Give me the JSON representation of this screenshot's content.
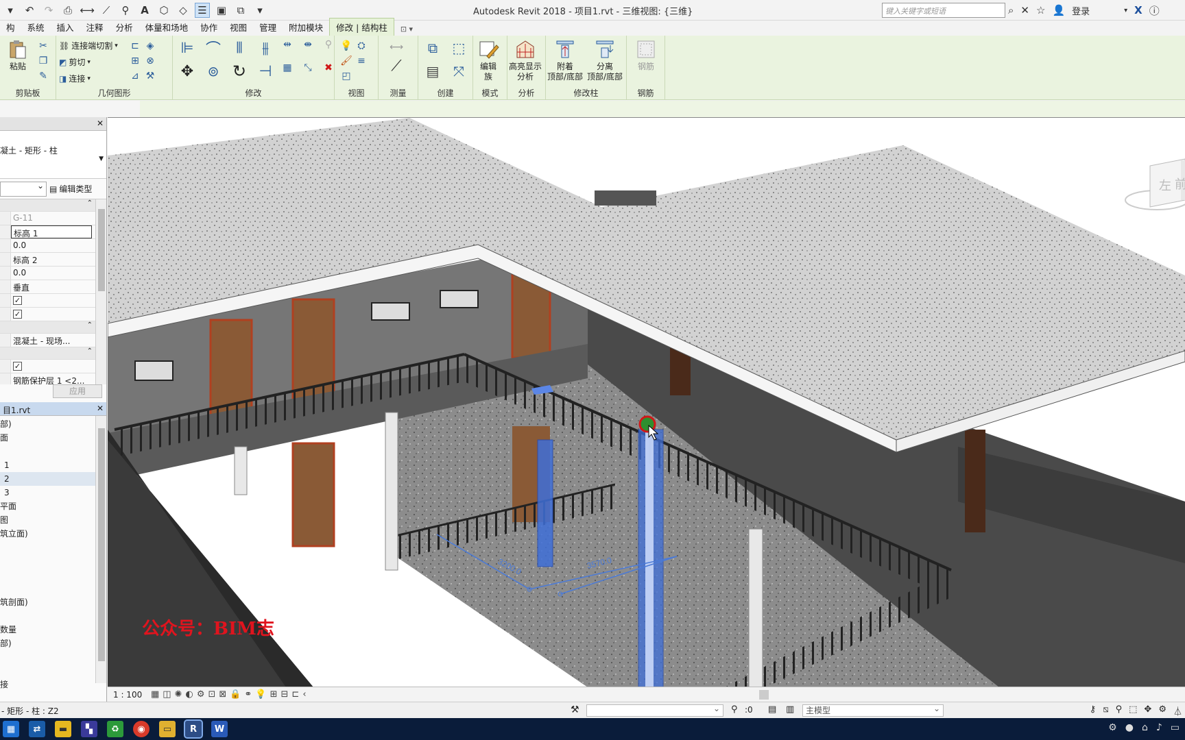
{
  "app": {
    "title": "Autodesk Revit 2018 -    项目1.rvt - 三维视图: {三维}",
    "search_placeholder": "键入关键字或短语",
    "login_label": "登录"
  },
  "qat": {
    "icons": [
      "open-icon",
      "undo-icon",
      "redo-icon",
      "print-icon",
      "measure-icon",
      "dimension-icon",
      "tag-icon",
      "text-icon",
      "3d-view-icon",
      "section-icon",
      "thin-lines-icon",
      "close-hidden-icon",
      "switch-windows-icon",
      "customize-icon"
    ]
  },
  "tabs": [
    {
      "label": "构"
    },
    {
      "label": "系统"
    },
    {
      "label": "插入"
    },
    {
      "label": "注释"
    },
    {
      "label": "分析"
    },
    {
      "label": "体量和场地"
    },
    {
      "label": "协作"
    },
    {
      "label": "视图"
    },
    {
      "label": "管理"
    },
    {
      "label": "附加模块"
    },
    {
      "label": "修改 | 结构柱",
      "active": true
    },
    {
      "label": "⊡ ▾",
      "tiny": true
    }
  ],
  "ribbon": {
    "clipboard": {
      "paste": "粘贴",
      "label": "剪贴板"
    },
    "geometry": {
      "cut_join": "连接端切割",
      "cut": "剪切",
      "join": "连接",
      "label": "几何图形"
    },
    "modify": {
      "label": "修改"
    },
    "view": {
      "label": "视图"
    },
    "measure": {
      "label": "测量"
    },
    "create": {
      "label": "创建"
    },
    "mode": {
      "edit_family": "编辑\n族",
      "label": "模式"
    },
    "analysis": {
      "highlight": "高亮显示\n分析",
      "label": "分析"
    },
    "modify_column": {
      "attach": "附着\n顶部/底部",
      "detach": "分离\n顶部/底部",
      "label": "修改柱"
    },
    "rebar": {
      "rebar": "钢筋",
      "label": "钢筋"
    }
  },
  "properties": {
    "type_name": "凝土 - 矩形 - 柱",
    "edit_type": "编辑类型",
    "rows": [
      {
        "kind": "group"
      },
      {
        "value": "G-11",
        "gray": true
      },
      {
        "value": "标高 1",
        "boxed": true
      },
      {
        "value": "0.0"
      },
      {
        "value": "标高 2"
      },
      {
        "value": "0.0"
      },
      {
        "value": "垂直"
      },
      {
        "kind": "check",
        "checked": true
      },
      {
        "kind": "check",
        "checked": true
      },
      {
        "kind": "group"
      },
      {
        "value": "混凝土 - 现场..."
      },
      {
        "kind": "group"
      },
      {
        "kind": "check",
        "checked": true
      },
      {
        "value": "钢筋保护层 1 <2..."
      }
    ],
    "apply": "应用"
  },
  "browser": {
    "title": "目1.rvt",
    "items": [
      "部)",
      "面",
      "",
      "1",
      "2",
      "3",
      "平面",
      "图",
      "筑立面)",
      "",
      "",
      "",
      "",
      "筑剖面)",
      "",
      "数量",
      "部)",
      "",
      "",
      "接"
    ]
  },
  "viewport": {
    "watermark": "公众号：BIM志",
    "dim1": "3200.0",
    "dim2": "3570.0",
    "viewcube_left": "左",
    "viewcube_front": "前"
  },
  "view_control": {
    "scale": "1 : 100"
  },
  "status": {
    "text": "- 矩形 - 柱 : Z2",
    "workset_value": ":0",
    "model": "主模型"
  },
  "colors": {
    "ribbon_bg": "#eaf3df",
    "roof": "#d2d2d2",
    "wall": "#7a7a7a",
    "door": "#8a5a36",
    "selection": "#2f63d6",
    "watermark": "#e0141e"
  }
}
